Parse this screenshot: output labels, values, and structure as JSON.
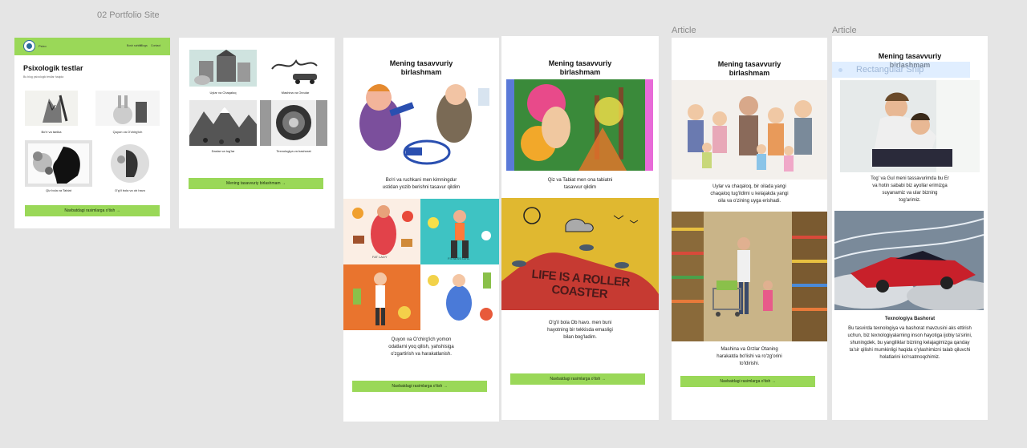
{
  "canvas": {
    "group_label": "02 Portfolio Site",
    "article_label_1": "Article",
    "article_label_2": "Article"
  },
  "frame1": {
    "logo_text": "Psixo",
    "nav_items": [
      "Bosh sahifa",
      "Blogs",
      "Blog",
      "Contact"
    ],
    "hero_title": "Psixologik testlar",
    "hero_sub": "Bu blog psixologik testlar haqida",
    "cards": [
      "Bo'ri va tanlka",
      "Quyon va O'chirg'ich",
      "Qiz bola va Tabiat",
      "O'g'il bola va ob havo"
    ],
    "cta": "Navbatdagi rasimlarga o'tish →"
  },
  "frame2": {
    "cards": [
      "Uylar va Chaqaloq",
      "Mashina va Orzular",
      "Daslar va tog'lar",
      "Texnologiya va bashorat"
    ],
    "cta": "Mening tasavvuriy birlashmam →"
  },
  "frame3": {
    "title_1": "Mening tasavvuriy",
    "title_2": "birlashmam",
    "cap1_1": "Bo'ri va ruchkani men kimningdur",
    "cap1_2": "ustidan yozib berishni tasavur qildim",
    "tag_fat": "FAT LADY",
    "tag_fit": "FITNESS GIRL",
    "cap2_1": "Quyon va O'chirg'ich yomon",
    "cap2_2": "odatlarni yoq qilish, yahshisiga",
    "cap2_3": "o'zgartirish va harakatlanish.",
    "cta": "Navbatdagi rasimlarga o'tish →"
  },
  "frame4": {
    "title_1": "Mening tasavvuriy",
    "title_2": "birlashmam",
    "cap1_1": "Qiz va Tabiat men ona tabiatni",
    "cap1_2": "tasavvur qildim",
    "poster_text": "LIFE IS A ROLLER COASTER",
    "cap2_1": "O'g'il bola Ob havo. men buni",
    "cap2_2": "hayotning bir tekkisda emasligi",
    "cap2_3": "bilan bog'ladim.",
    "cta": "Navbatdagi rasimlarga o'tish →"
  },
  "frame5": {
    "title_1": "Mening tasavvuriy",
    "title_2": "birlashmam",
    "cap1_1": "Uylar va chaqaloq, bir oilada yangi",
    "cap1_2": "chaqaloq tug'ildimi u kelajakda yangi",
    "cap1_3": "oila va o'zining uyga erishadi.",
    "cap2_1": "Mashina va Orzlar Otaning",
    "cap2_2": "harakatda bo'lishi va ro'zg'orini",
    "cap2_3": "to'ldirishi.",
    "cta": "Navbatdagi rasimlarga o'tish →"
  },
  "frame6": {
    "title_1": "Mening tasavvuriy",
    "title_2": "birlashmam",
    "selection_label": "Rectangular Snip",
    "cap1_1": "Tog' va Gul meni tassavurimda bu Er",
    "cap1_2": "va hotin sababi biz ayollar erimizga",
    "cap1_3": "suyanamiz va ular bizning",
    "cap1_4": "tog'arimiz.",
    "sub_title": "Texnologiya Bashorat",
    "body_1": "Bu tasvirda texnologiya va bashorat mavzusini aks ettirish",
    "body_2": "uchun, biz texnologiyalarning inson hayotiga ijobiy ta'sirini,",
    "body_3": "shuningdek, bu yangiliklar bizning kelajagimizga qanday",
    "body_4": "ta'sir qilishi mumkinligi haqida o'ylashimizni talab qiluvchi",
    "body_5": "holatlarini ko'rsatmoqchimiz."
  }
}
